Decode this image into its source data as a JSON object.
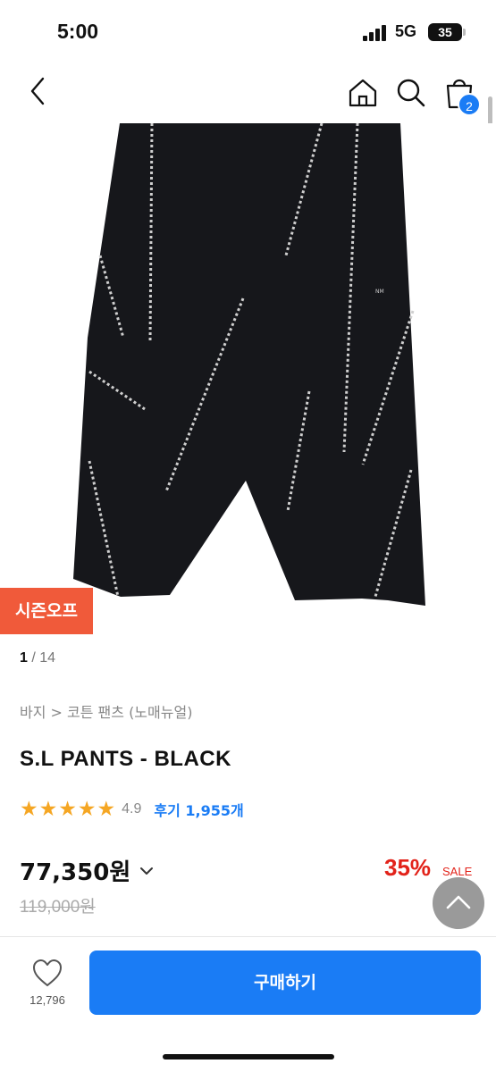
{
  "status_bar": {
    "time": "5:00",
    "network": "5G",
    "battery": "35"
  },
  "nav": {
    "cart_count": "2"
  },
  "product": {
    "season_badge": "시즌오프",
    "image_index": "1",
    "image_total": "14",
    "breadcrumb": "바지 > 코튼 팬츠 (노매뉴얼)",
    "title": "S.L PANTS - BLACK",
    "stars": "★★★★★",
    "rating": "4.9",
    "review_label": "후기 1,955개",
    "price": "77,350원",
    "original_price": "119,000원",
    "discount": "35%",
    "sale_label": "SALE"
  },
  "bottom_bar": {
    "wish_count": "12,796",
    "buy_label": "구매하기"
  },
  "colors": {
    "accent": "#1a7cf5",
    "discount": "#e2231a",
    "badge": "#f05a3a",
    "star": "#f5a623"
  },
  "icons": [
    "back-icon",
    "home-icon",
    "search-icon",
    "cart-icon",
    "chevron-down-icon",
    "heart-icon",
    "arrow-up-icon"
  ]
}
